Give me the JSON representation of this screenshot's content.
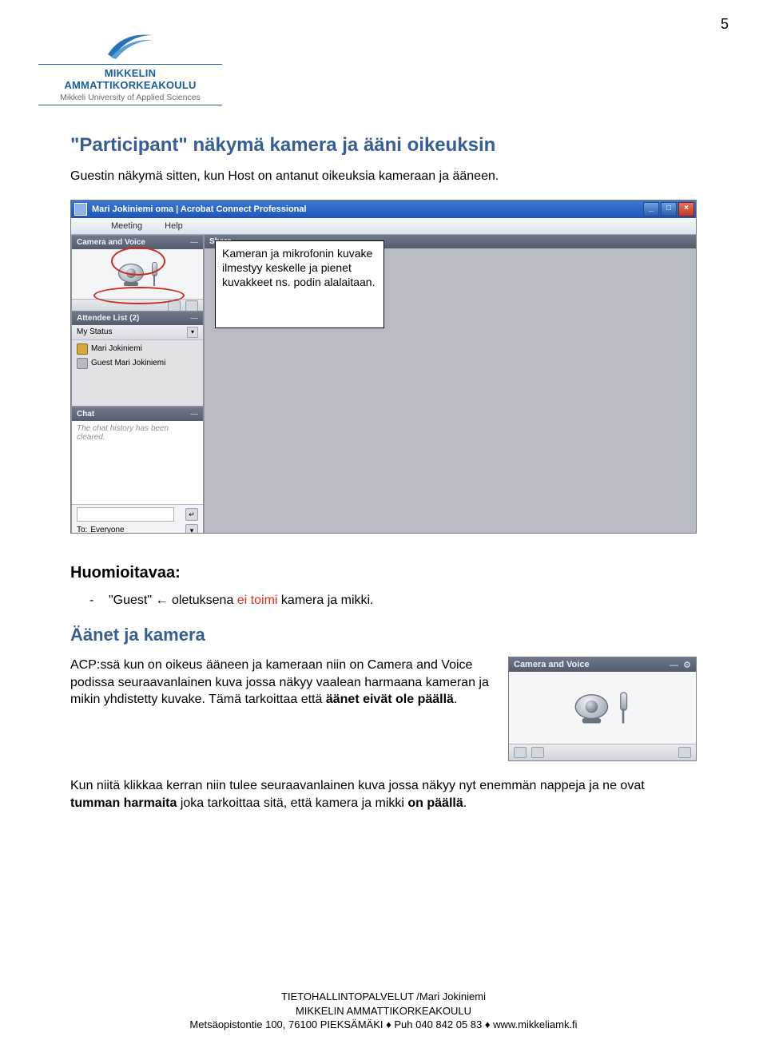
{
  "page_number": "5",
  "logo": {
    "line1": "MIKKELIN AMMATTIKORKEAKOULU",
    "line2": "Mikkeli University of Applied Sciences"
  },
  "h1": "\"Participant\" näkymä kamera ja ääni oikeuksin",
  "intro": "Guestin näkymä sitten, kun Host on antanut oikeuksia kameraan ja ääneen.",
  "screenshot": {
    "titlebar": "Mari Jokiniemi oma | Acrobat Connect Professional",
    "menu1": "Meeting",
    "menu2": "Help",
    "camvoice_header": "Camera and Voice",
    "share_header": "Share",
    "attendee_header": "Attendee List (2)",
    "attendee_status": "My Status",
    "attendee_name1": "Mari Jokiniemi",
    "attendee_name2": "Guest Mari Jokiniemi",
    "chat_header": "Chat",
    "chat_body": "The chat history has been cleared.",
    "to_label": "To:",
    "to_target": "Everyone",
    "callout": "Kameran ja mikrofonin kuvake ilmestyy keskelle ja pienet kuvakkeet ns. podin alalaitaan."
  },
  "huomio_label": "Huomioitavaa:",
  "huomio_bullet_pre": "\"Guest\" ",
  "huomio_bullet_arrow": "←",
  "huomio_bullet_mid": " oletuksena ",
  "huomio_bullet_red": "ei toimi",
  "huomio_bullet_post": " kamera ja mikki.",
  "h2": "Äänet ja kamera",
  "para2a": "ACP:ssä kun on oikeus ääneen ja kameraan niin on Camera and Voice podissa seuraavanlainen kuva jossa näkyy vaalean harmaana kameran ja mikin yhdistetty kuvake. Tämä tarkoittaa että ",
  "para2b": "äänet eivät ole päällä",
  "para2c": ".",
  "thumb_header": "Camera and Voice",
  "para3a": "Kun niitä klikkaa kerran niin tulee seuraavanlainen kuva jossa näkyy nyt enemmän nappeja ja ne ovat ",
  "para3b": "tumman harmaita",
  "para3c": " joka tarkoittaa sitä, että kamera ja mikki ",
  "para3d": "on päällä",
  "para3e": ".",
  "footer": {
    "line1": "TIETOHALLINTOPALVELUT /Mari Jokiniemi",
    "line2": "MIKKELIN AMMATTIKORKEAKOULU",
    "line3": "Metsäopistontie 100, 76100 PIEKSÄMÄKI ♦ Puh 040 842 05 83 ♦ www.mikkeliamk.fi"
  }
}
